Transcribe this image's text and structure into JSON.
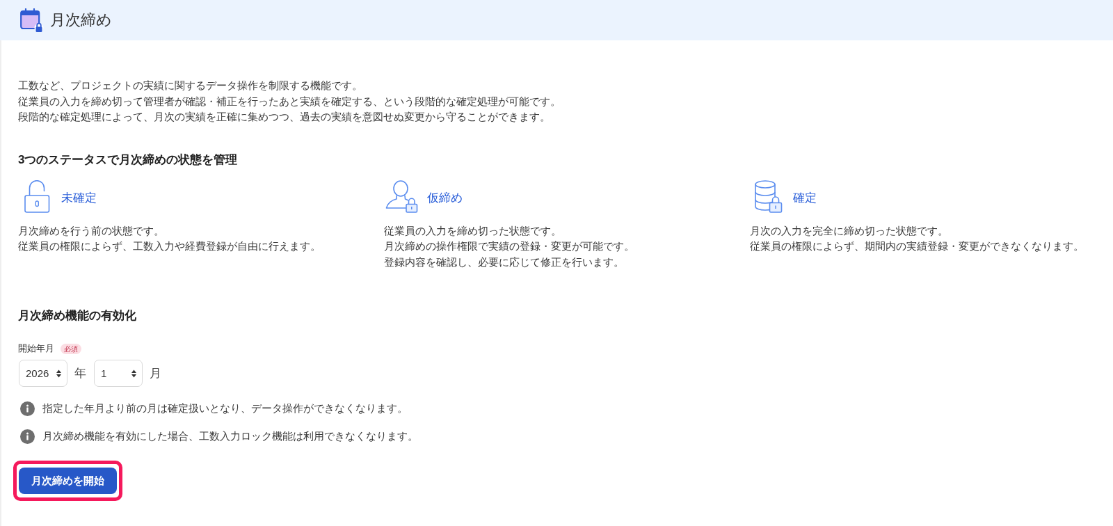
{
  "header": {
    "title": "月次締め"
  },
  "intro": [
    "工数など、プロジェクトの実績に関するデータ操作を制限する機能です。",
    "従業員の入力を締め切って管理者が確認・補正を行ったあと実績を確定する、という段階的な確定処理が可能です。",
    "段階的な確定処理によって、月次の実績を正確に集めつつ、過去の実績を意図せぬ変更から守ることができます。"
  ],
  "status_section": {
    "heading": "3つのステータスで月次締めの状態を管理",
    "statuses": [
      {
        "kind": "unlocked",
        "title": "未確定",
        "description": [
          "月次締めを行う前の状態です。",
          "従業員の権限によらず、工数入力や経費登録が自由に行えます。"
        ]
      },
      {
        "kind": "person-lock",
        "title": "仮締め",
        "description": [
          "従業員の入力を締め切った状態です。",
          "月次締めの操作権限で実績の登録・変更が可能です。",
          "登録内容を確認し、必要に応じて修正を行います。"
        ]
      },
      {
        "kind": "database-lock",
        "title": "確定",
        "description": [
          "月次の入力を完全に締め切った状態です。",
          "従業員の権限によらず、期間内の実績登録・変更ができなくなります。"
        ]
      }
    ]
  },
  "enable_section": {
    "heading": "月次締め機能の有効化",
    "start_month": {
      "label": "開始年月",
      "required_badge": "必須",
      "year": {
        "value": "2026",
        "unit": "年"
      },
      "month": {
        "value": "1",
        "unit": "月"
      }
    },
    "notes": [
      "指定した年月より前の月は確定扱いとなり、データ操作ができなくなります。",
      "月次締め機能を有効にした場合、工数入力ロック機能は利用できなくなります。"
    ],
    "start_button": {
      "label": "月次締めを開始",
      "highlighted": true
    }
  }
}
